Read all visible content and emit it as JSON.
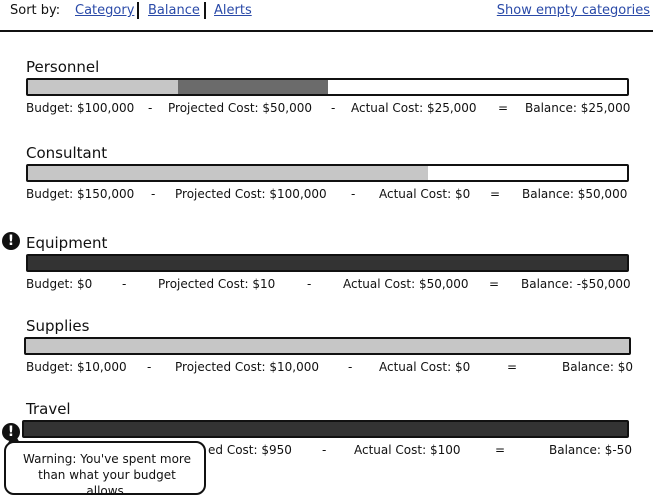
{
  "sort": {
    "label": "Sort by:",
    "options": [
      "Category",
      "Balance",
      "Alerts"
    ],
    "show_empty": "Show empty categories"
  },
  "categories": [
    {
      "name": "Personnel",
      "budget": "Budget: $100,000",
      "op1": "-",
      "projected": "Projected Cost: $50,000",
      "op2": "-",
      "actual": "Actual Cost: $25,000",
      "op3": "=",
      "balance": "Balance: $25,000",
      "projected_fraction": 0.5,
      "actual_fraction": 0.25,
      "alert": false
    },
    {
      "name": "Consultant",
      "budget": "Budget: $150,000",
      "op1": "-",
      "projected": "Projected Cost: $100,000",
      "op2": "-",
      "actual": "Actual Cost: $0",
      "op3": "=",
      "balance": "Balance: $50,000",
      "projected_fraction": 0.667,
      "actual_fraction": 0,
      "alert": false
    },
    {
      "name": "Equipment",
      "budget": "Budget: $0",
      "op1": "-",
      "projected": "Projected Cost: $10",
      "op2": "-",
      "actual": "Actual Cost: $50,000",
      "op3": "=",
      "balance": "Balance: -$50,000",
      "projected_fraction": 1,
      "actual_fraction": 1,
      "alert": true
    },
    {
      "name": "Supplies",
      "budget": "Budget: $10,000",
      "op1": "-",
      "projected": "Projected Cost: $10,000",
      "op2": "-",
      "actual": "Actual Cost: $0",
      "op3": "=",
      "balance": "Balance: $0",
      "projected_fraction": 1,
      "actual_fraction": 0,
      "alert": false
    },
    {
      "name": "Travel",
      "budget": "",
      "op1": "",
      "projected": "ed Cost: $950",
      "op2": "-",
      "actual": "Actual Cost: $100",
      "op3": "=",
      "balance": "Balance: $-50",
      "projected_fraction": 1,
      "actual_fraction": 1,
      "alert": true
    }
  ],
  "alert_icon_glyph": "!",
  "tooltip": {
    "text": "Warning: You've spent more than what your budget allows."
  },
  "colors": {
    "link": "#2a4aa8",
    "projected_fill": "#c6c6c6",
    "actual_fill": "#6b6b6b",
    "over_budget_fill": "#333333"
  }
}
